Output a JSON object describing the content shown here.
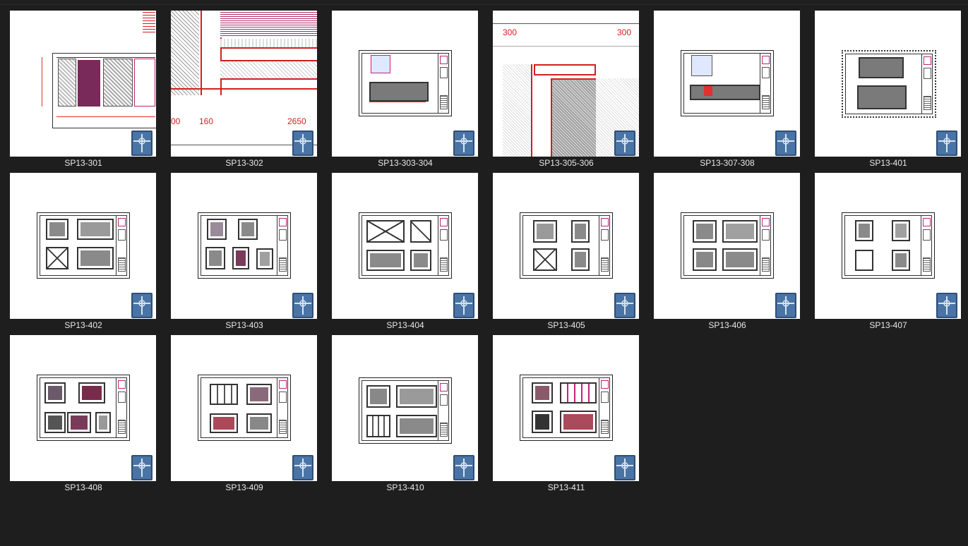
{
  "window": {
    "view_mode": "large-icons"
  },
  "colors": {
    "background": "#1e1e1e",
    "label_text": "#e8e8e8",
    "thumb_bg": "#ffffff",
    "cad_red": "#e03030",
    "cad_magenta": "#c0237a"
  },
  "files": [
    {
      "name": "SP13-301",
      "icon": "dwg-file-icon"
    },
    {
      "name": "SP13-302",
      "icon": "dwg-file-icon"
    },
    {
      "name": "SP13-303-304",
      "icon": "dwg-file-icon"
    },
    {
      "name": "SP13-305-306",
      "icon": "dwg-file-icon"
    },
    {
      "name": "SP13-307-308",
      "icon": "dwg-file-icon"
    },
    {
      "name": "SP13-401",
      "icon": "dwg-file-icon"
    },
    {
      "name": "SP13-402",
      "icon": "dwg-file-icon"
    },
    {
      "name": "SP13-403",
      "icon": "dwg-file-icon"
    },
    {
      "name": "SP13-404",
      "icon": "dwg-file-icon"
    },
    {
      "name": "SP13-405",
      "icon": "dwg-file-icon"
    },
    {
      "name": "SP13-406",
      "icon": "dwg-file-icon"
    },
    {
      "name": "SP13-407",
      "icon": "dwg-file-icon"
    },
    {
      "name": "SP13-408",
      "icon": "dwg-file-icon"
    },
    {
      "name": "SP13-409",
      "icon": "dwg-file-icon"
    },
    {
      "name": "SP13-410",
      "icon": "dwg-file-icon"
    },
    {
      "name": "SP13-411",
      "icon": "dwg-file-icon"
    }
  ],
  "preview_text": {
    "t302_a": "00",
    "t302_b": "160",
    "t302_c": "2650",
    "t305_a": "300",
    "t305_b": "300"
  }
}
